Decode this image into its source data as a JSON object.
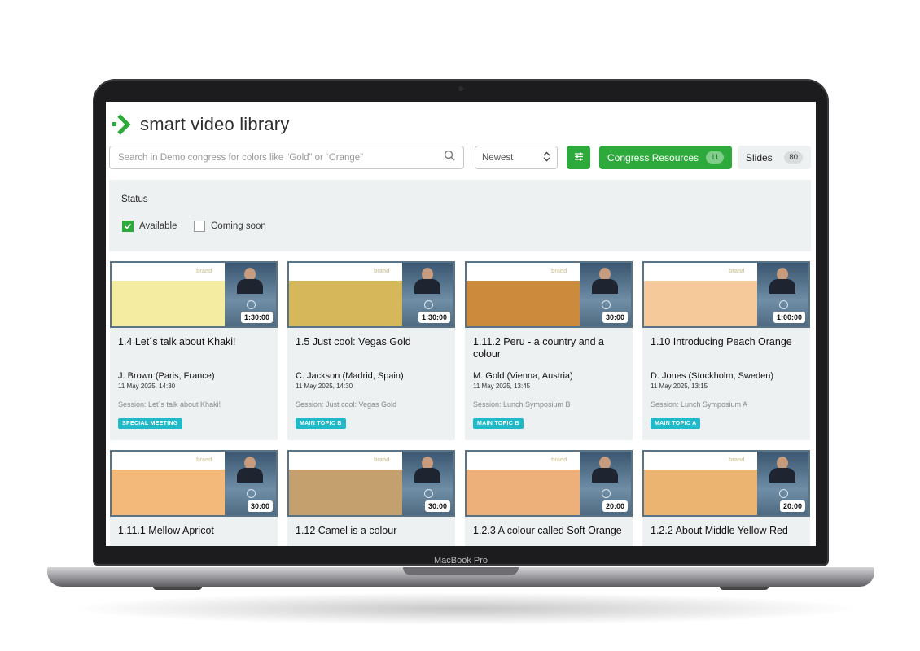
{
  "device": {
    "label": "MacBook Pro"
  },
  "app": {
    "title": "smart video library",
    "brand_color": "#2eaa3c"
  },
  "search": {
    "placeholder": "Search in Demo congress for colors like “Gold” or “Orange”"
  },
  "sort": {
    "selected": "Newest"
  },
  "tabs": [
    {
      "label": "Congress Resources",
      "count": "11"
    },
    {
      "label": "Slides",
      "count": "80"
    }
  ],
  "filters": {
    "title": "Status",
    "options": [
      {
        "label": "Available",
        "checked": true
      },
      {
        "label": "Coming soon",
        "checked": false
      }
    ]
  },
  "thumb_brand": "brand",
  "cards": [
    {
      "title": "1.4 Let´s talk about Khaki!",
      "speaker": "J. Brown (Paris, France)",
      "date": "11 May 2025, 14:30",
      "session": "Session: Let´s talk about Khaki!",
      "tag": "SPECIAL MEETING",
      "duration": "1:30:00",
      "color": "#f4eca0"
    },
    {
      "title": "1.5 Just cool: Vegas Gold",
      "speaker": "C. Jackson (Madrid, Spain)",
      "date": "11 May 2025, 14:30",
      "session": "Session: Just cool: Vegas Gold",
      "tag": "MAIN TOPIC B",
      "duration": "1:30:00",
      "color": "#d6b85a"
    },
    {
      "title": "1.11.2 Peru - a country and a colour",
      "speaker": "M. Gold (Vienna, Austria)",
      "date": "11 May 2025, 13:45",
      "session": "Session: Lunch Symposium B",
      "tag": "MAIN TOPIC B",
      "duration": "30:00",
      "color": "#cc8b3c"
    },
    {
      "title": "1.10 Introducing Peach Orange",
      "speaker": "D. Jones (Stockholm, Sweden)",
      "date": "11 May 2025, 13:15",
      "session": "Session: Lunch Symposium A",
      "tag": "MAIN TOPIC A",
      "duration": "1:00:00",
      "color": "#f6c99a"
    },
    {
      "title": "1.11.1 Mellow Apricot",
      "duration": "30:00",
      "color": "#f3b97a"
    },
    {
      "title": "1.12 Camel is a colour",
      "duration": "30:00",
      "color": "#c3a06d"
    },
    {
      "title": "1.2.3 A colour called Soft Orange",
      "duration": "20:00",
      "color": "#edb07a"
    },
    {
      "title": "1.2.2 About Middle Yellow Red",
      "duration": "20:00",
      "color": "#ebb471"
    }
  ]
}
